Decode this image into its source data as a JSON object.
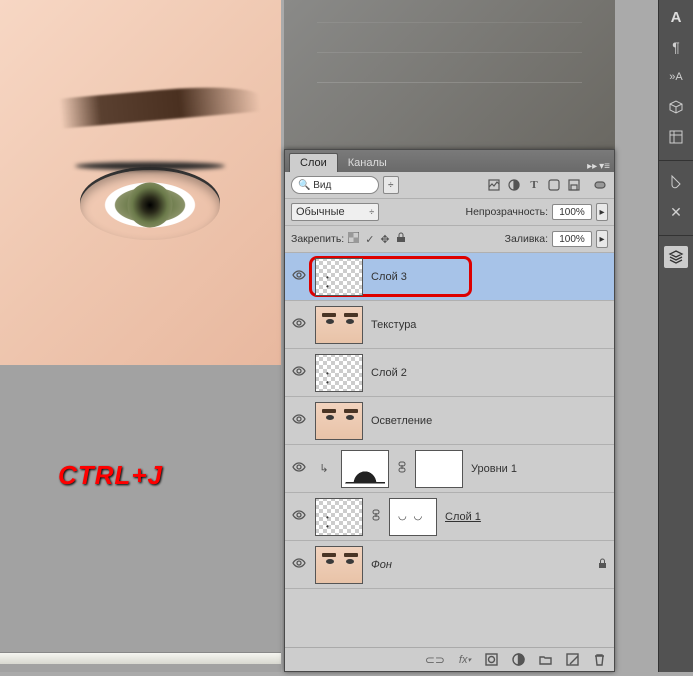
{
  "overlay_text": "CTRL+J",
  "panel": {
    "tabs": [
      {
        "label": "Слои",
        "active": true
      },
      {
        "label": "Каналы",
        "active": false
      }
    ],
    "search_placeholder": "Вид",
    "blend_mode": "Обычные",
    "opacity_label": "Непрозрачность:",
    "opacity_value": "100%",
    "lock_label": "Закрепить:",
    "fill_label": "Заливка:",
    "fill_value": "100%"
  },
  "filter_icons": [
    "image-icon",
    "adjustment-icon",
    "type-icon",
    "shape-icon",
    "smartobject-icon"
  ],
  "layers": [
    {
      "name": "Слой 3",
      "selected": true,
      "thumb": "transparent-dots",
      "highlighted": true
    },
    {
      "name": "Текстура",
      "thumb": "face"
    },
    {
      "name": "Слой 2",
      "thumb": "transparent-dots"
    },
    {
      "name": "Осветление",
      "thumb": "face"
    },
    {
      "name": "Уровни 1",
      "thumb": "levels",
      "adjustment": true
    },
    {
      "name": "Слой 1",
      "thumb": "transparent-dots",
      "mask": true,
      "underline": true
    },
    {
      "name": "Фон",
      "thumb": "face",
      "italic": true,
      "locked": true
    }
  ],
  "footer_icons": [
    "link-icon",
    "fx-icon",
    "mask-icon",
    "adjustment-icon",
    "group-icon",
    "new-layer-icon",
    "trash-icon"
  ],
  "rail_icons": [
    "character-icon",
    "paragraph-icon",
    "glyph-icon",
    "3d-icon",
    "libraries-icon",
    "divider",
    "swatches-icon",
    "brushes-icon",
    "divider",
    "layers-icon"
  ]
}
